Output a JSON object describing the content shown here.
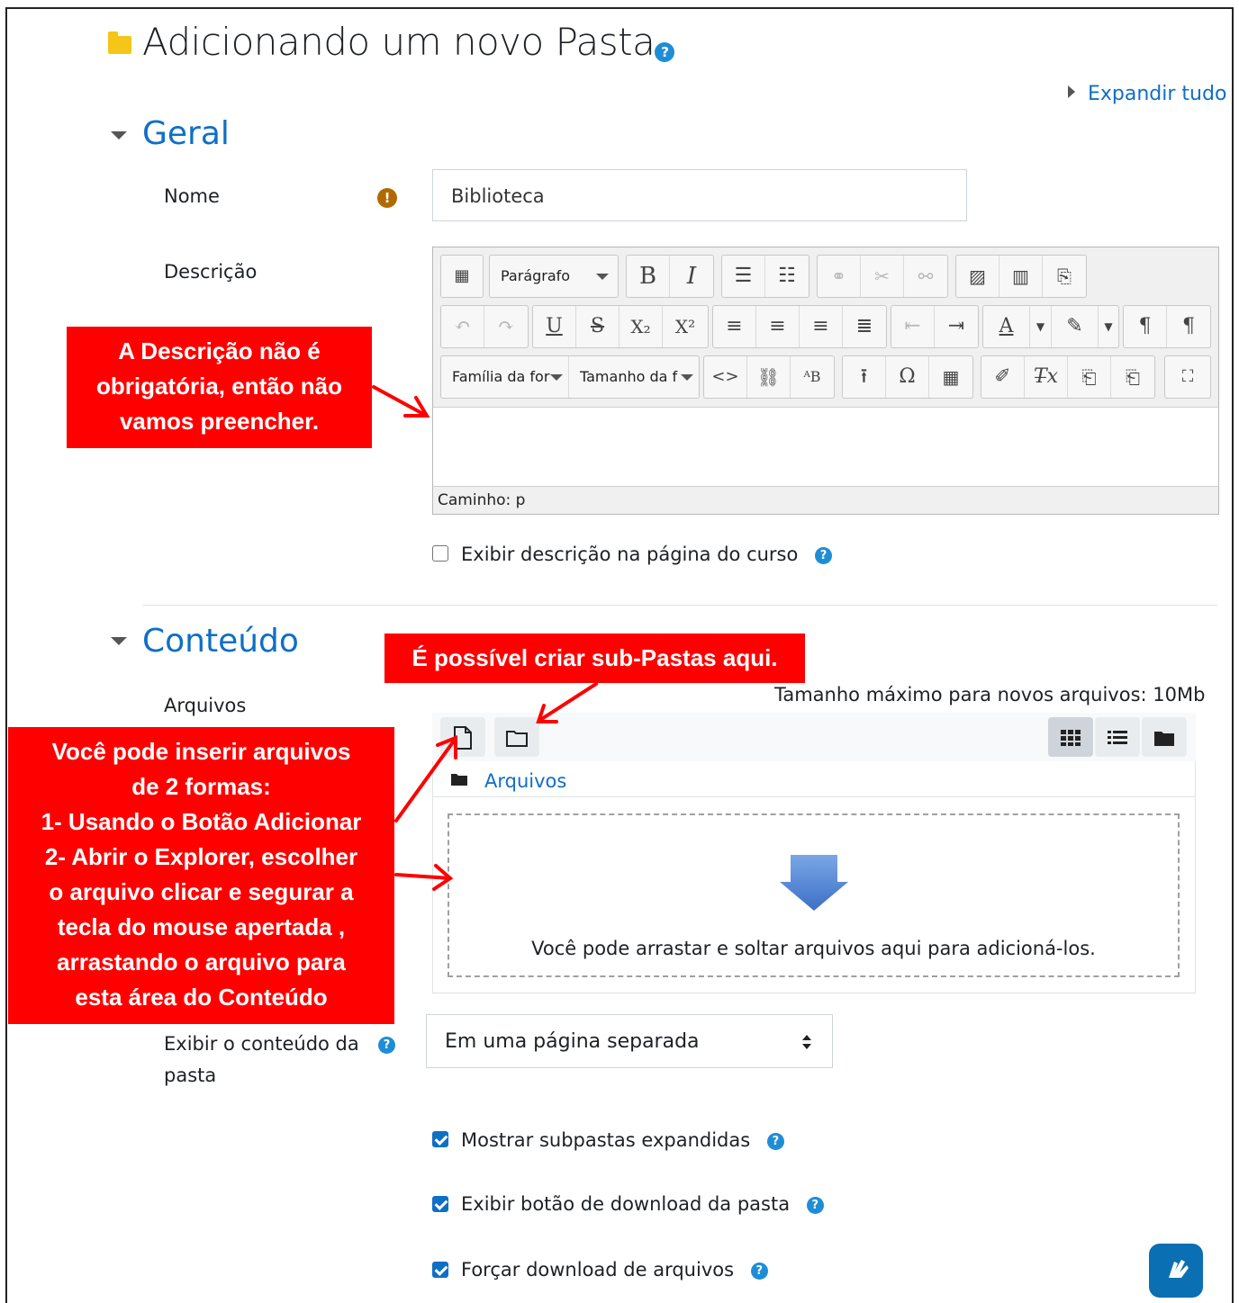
{
  "page": {
    "title": "Adicionando um novo Pasta",
    "expand_all": "Expandir tudo"
  },
  "sections": {
    "geral": "Geral",
    "conteudo": "Conteúdo"
  },
  "form": {
    "nome_label": "Nome",
    "nome_value": "Biblioteca",
    "descricao_label": "Descrição",
    "editor": {
      "paragraph_select": "Parágrafo",
      "font_family_select": "Família da for",
      "font_size_select": "Tamanho da f",
      "path": "Caminho: p"
    },
    "show_description": "Exibir descrição na página do curso",
    "arquivos_label": "Arquivos",
    "max_size": "Tamanho máximo para novos arquivos: 10Mb",
    "filemanager_path": "Arquivos",
    "drop_hint": "Você pode arrastar e soltar arquivos aqui para adicioná-los.",
    "display_label_line1": "Exibir o conteúdo da",
    "display_label_line2": "pasta",
    "display_value": "Em uma página separada",
    "show_subfolders": "Mostrar subpastas expandidas",
    "show_download": "Exibir botão de download da pasta",
    "force_download": "Forçar download de arquivos",
    "checkboxes": {
      "show_description": false,
      "show_subfolders": true,
      "show_download": true,
      "force_download": true
    }
  },
  "callouts": {
    "description": [
      "A Descrição não é",
      "obrigatória, então não",
      "vamos preencher."
    ],
    "subfolders": "É possível criar sub-Pastas aqui.",
    "files": [
      "Você pode inserir arquivos",
      "de 2 formas:",
      "1- Usando o Botão Adicionar",
      "2- Abrir o Explorer, escolher",
      "o arquivo clicar e segurar a",
      "tecla do mouse apertada ,",
      "arrastando o arquivo para",
      "esta área do Conteúdo"
    ]
  },
  "colors": {
    "link": "#0f6fc5",
    "callout": "#ff0000",
    "help": "#1f8dd6",
    "folder_icon": "#f5c518"
  }
}
